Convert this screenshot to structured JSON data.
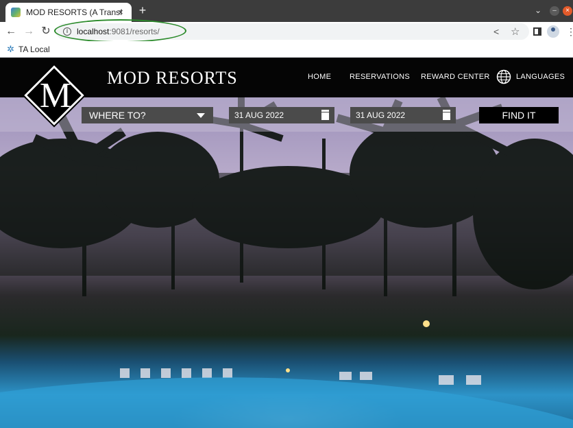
{
  "browser": {
    "tab_title": "MOD RESORTS (A Transfo",
    "tab_close": "×",
    "new_tab": "+",
    "url_host": "localhost",
    "url_rest": ":9081/resorts/",
    "bookmark_label": "TA Local"
  },
  "header": {
    "logo_letter": "M",
    "brand": "MOD RESORTS",
    "nav": {
      "home": "HOME",
      "reservations": "RESERVATIONS",
      "reward": "REWARD CENTER",
      "languages": "LANGUAGES"
    }
  },
  "search": {
    "where": "WHERE TO?",
    "checkin": "31 AUG 2022",
    "checkout": "31 AUG 2022",
    "find": "FIND IT"
  },
  "icons": {
    "back": "arrow-left-icon",
    "forward": "arrow-right-icon",
    "reload": "reload-icon",
    "info": "info-icon",
    "share": "share-icon",
    "star": "star-icon",
    "globe": "globe-icon",
    "calendar": "calendar-icon",
    "caret": "caret-down-icon"
  },
  "colors": {
    "annotation": "#2a8a2a",
    "field_bg": "#4b4b4b",
    "header_bg": "#050505"
  }
}
